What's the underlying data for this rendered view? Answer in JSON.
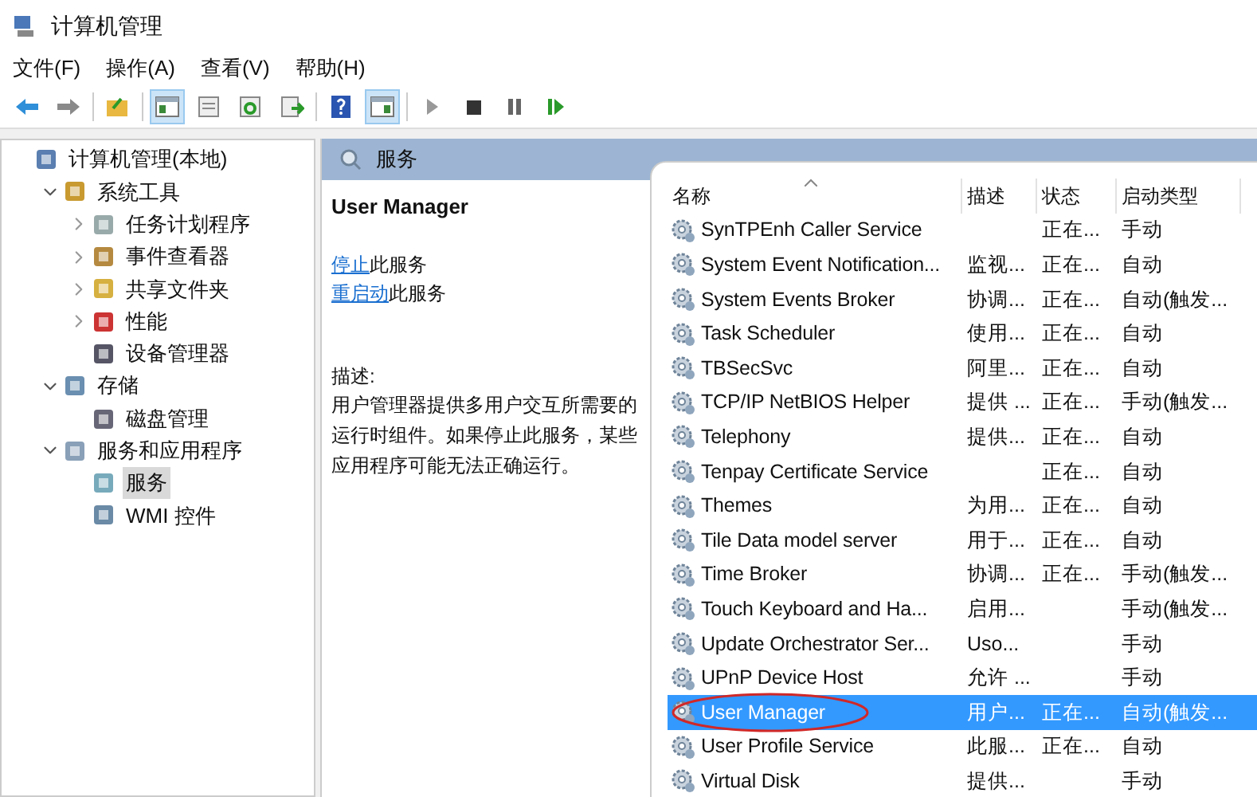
{
  "window": {
    "title": "计算机管理"
  },
  "menu": [
    "文件(F)",
    "操作(A)",
    "查看(V)",
    "帮助(H)"
  ],
  "toolbar": [
    {
      "pressed": false
    },
    {
      "pressed": false
    },
    {
      "pressed": false
    },
    {
      "pressed": true
    },
    {
      "pressed": false
    },
    {
      "pressed": false
    },
    {
      "pressed": false
    },
    {
      "pressed": false
    },
    {
      "pressed": true
    },
    {
      "pressed": false
    },
    {
      "pressed": false
    },
    {
      "pressed": false
    },
    {
      "pressed": false
    }
  ],
  "tree": [
    {
      "label": "计算机管理(本地)",
      "selected": false,
      "children": [
        {
          "label": "系统工具",
          "selected": false,
          "expanded": true,
          "children": [
            {
              "label": "任务计划程序",
              "selected": false,
              "expanded": false
            },
            {
              "label": "事件查看器",
              "selected": false,
              "expanded": false
            },
            {
              "label": "共享文件夹",
              "selected": false,
              "expanded": false
            },
            {
              "label": "性能",
              "selected": false,
              "expanded": false
            },
            {
              "label": "设备管理器",
              "selected": false
            }
          ]
        },
        {
          "label": "存储",
          "selected": false,
          "expanded": true,
          "children": [
            {
              "label": "磁盘管理",
              "selected": false
            }
          ]
        },
        {
          "label": "服务和应用程序",
          "selected": false,
          "expanded": true,
          "children": [
            {
              "label": "服务",
              "selected": true
            },
            {
              "label": "WMI 控件",
              "selected": false
            }
          ]
        }
      ]
    }
  ],
  "pane_header": {
    "title": "服务"
  },
  "details": {
    "service_name": "User Manager",
    "actions": [
      {
        "link": "停止",
        "text": "此服务"
      },
      {
        "link": "重启动",
        "text": "此服务"
      }
    ],
    "description_label": "描述:",
    "description": "用户管理器提供多用户交互所需要的运行时组件。如果停止此服务，某些应用程序可能无法正确运行。"
  },
  "table": {
    "columns": [
      "名称",
      "描述",
      "状态",
      "启动类型"
    ],
    "rows": [
      {
        "name": "SynTPEnh Caller Service",
        "description": "",
        "status": "正在...",
        "startup": "手动",
        "selected": false,
        "circled": false
      },
      {
        "name": "System Event Notification...",
        "description": "监视...",
        "status": "正在...",
        "startup": "自动",
        "selected": false,
        "circled": false
      },
      {
        "name": "System Events Broker",
        "description": "协调...",
        "status": "正在...",
        "startup": "自动(触发...",
        "selected": false,
        "circled": false
      },
      {
        "name": "Task Scheduler",
        "description": "使用...",
        "status": "正在...",
        "startup": "自动",
        "selected": false,
        "circled": false
      },
      {
        "name": "TBSecSvc",
        "description": "阿里...",
        "status": "正在...",
        "startup": "自动",
        "selected": false,
        "circled": false
      },
      {
        "name": "TCP/IP NetBIOS Helper",
        "description": "提供 ...",
        "status": "正在...",
        "startup": "手动(触发...",
        "selected": false,
        "circled": false
      },
      {
        "name": "Telephony",
        "description": "提供...",
        "status": "正在...",
        "startup": "自动",
        "selected": false,
        "circled": false
      },
      {
        "name": "Tenpay Certificate Service",
        "description": "",
        "status": "正在...",
        "startup": "自动",
        "selected": false,
        "circled": false
      },
      {
        "name": "Themes",
        "description": "为用...",
        "status": "正在...",
        "startup": "自动",
        "selected": false,
        "circled": false
      },
      {
        "name": "Tile Data model server",
        "description": "用于...",
        "status": "正在...",
        "startup": "自动",
        "selected": false,
        "circled": false
      },
      {
        "name": "Time Broker",
        "description": "协调...",
        "status": "正在...",
        "startup": "手动(触发...",
        "selected": false,
        "circled": false
      },
      {
        "name": "Touch Keyboard and Ha...",
        "description": "启用...",
        "status": "",
        "startup": "手动(触发...",
        "selected": false,
        "circled": false
      },
      {
        "name": "Update Orchestrator Ser...",
        "description": "Uso...",
        "status": "",
        "startup": "手动",
        "selected": false,
        "circled": false
      },
      {
        "name": "UPnP Device Host",
        "description": "允许 ...",
        "status": "",
        "startup": "手动",
        "selected": false,
        "circled": false
      },
      {
        "name": "User Manager",
        "description": "用户...",
        "status": "正在...",
        "startup": "自动(触发...",
        "selected": true,
        "circled": true
      },
      {
        "name": "User Profile Service",
        "description": "此服...",
        "status": "正在...",
        "startup": "自动",
        "selected": false,
        "circled": false
      },
      {
        "name": "Virtual Disk",
        "description": "提供...",
        "status": "",
        "startup": "手动",
        "selected": false,
        "circled": false
      }
    ]
  }
}
